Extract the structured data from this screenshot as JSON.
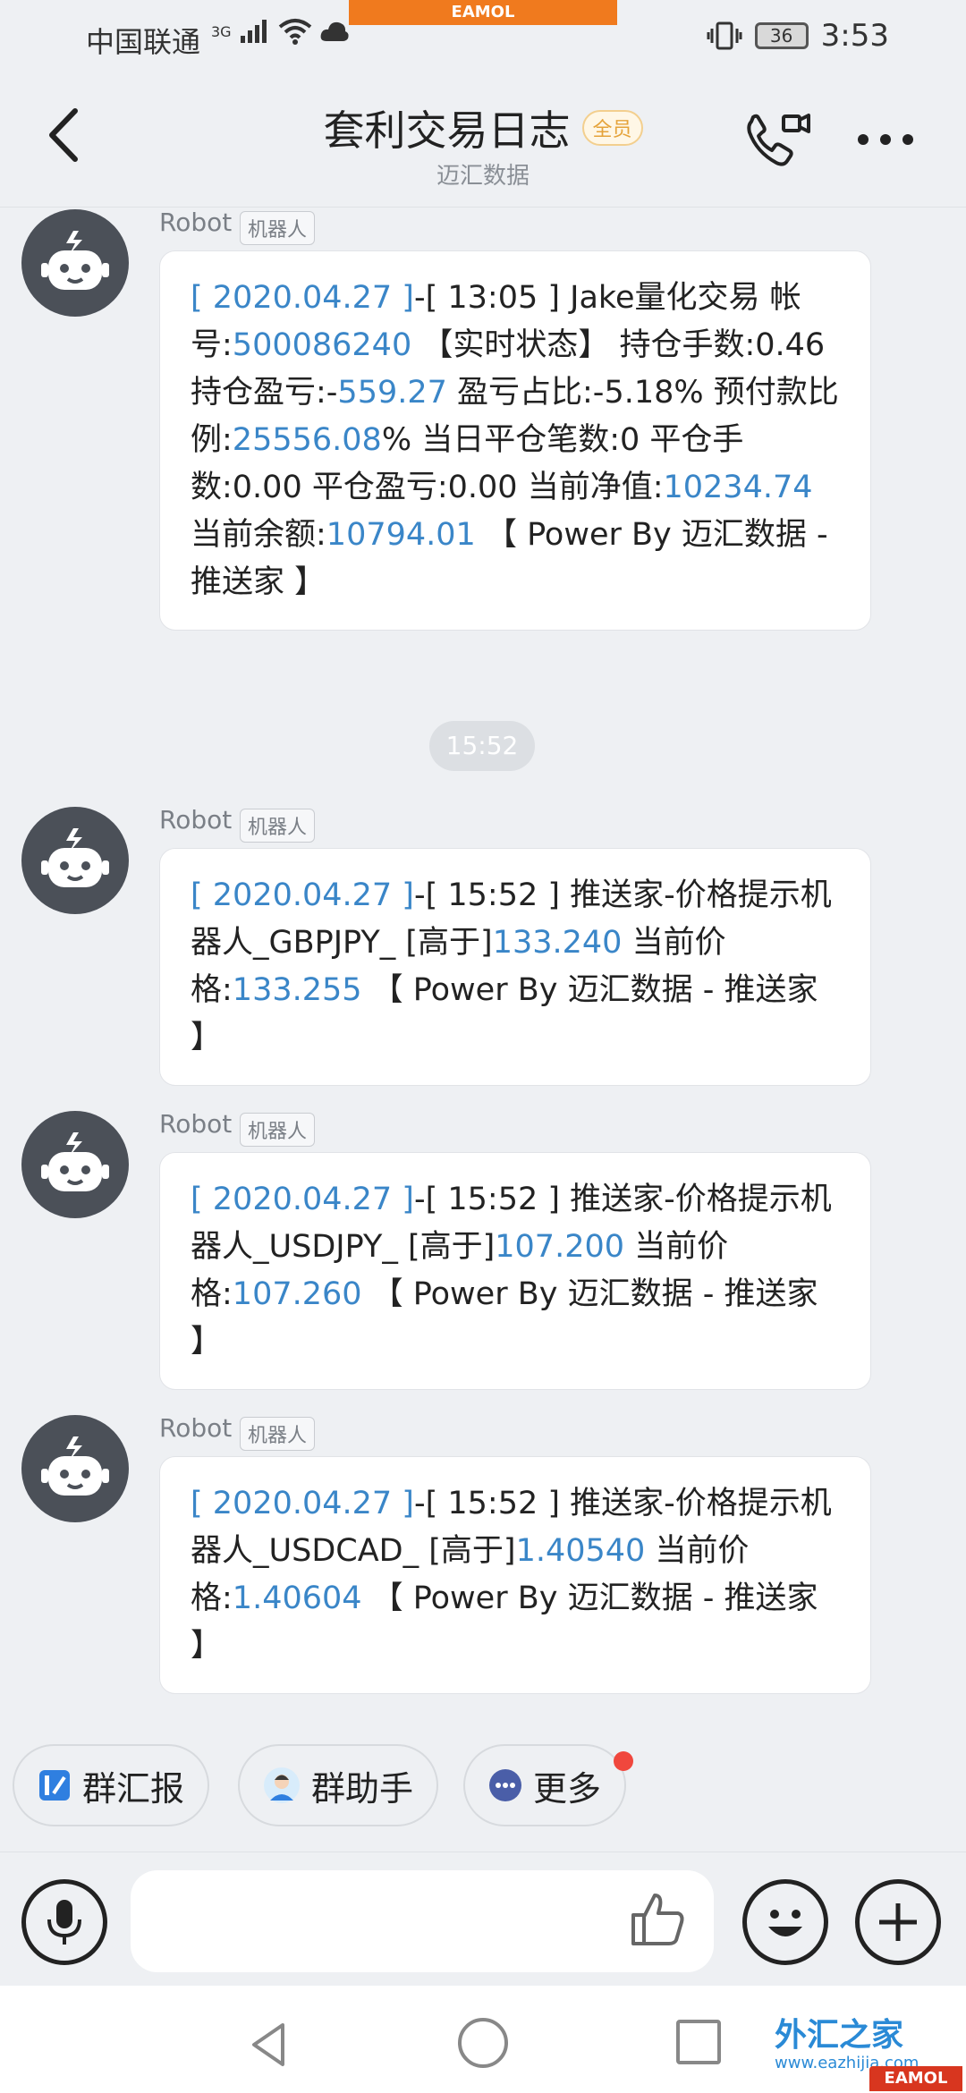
{
  "status_bar": {
    "carrier": "中国联通",
    "network": "3G",
    "battery": "36",
    "time": "3:53",
    "banner": "EAMOL"
  },
  "header": {
    "title": "套利交易日志",
    "member_badge": "全员",
    "subtitle": "迈汇数据"
  },
  "messages": [
    {
      "sender": "Robot",
      "tag": "机器人",
      "parts": [
        {
          "t": "[ 2020.04.27 ]",
          "b": true
        },
        {
          "t": "-[ 13:05 ] Jake量化交易  帐号:",
          "b": false
        },
        {
          "t": "500086240",
          "b": true
        },
        {
          "t": " 【实时状态】 持仓手数:0.46 持仓盈亏:-",
          "b": false
        },
        {
          "t": "559.27",
          "b": true
        },
        {
          "t": "  盈亏占比:-5.18%   预付款比例:",
          "b": false
        },
        {
          "t": "25556.08",
          "b": true
        },
        {
          "t": "%  当日平仓笔数:0   平仓手数:0.00  平仓盈亏:0.00  当前净值:",
          "b": false
        },
        {
          "t": "10234.74",
          "b": true
        },
        {
          "t": " 当前余额:",
          "b": false
        },
        {
          "t": "10794.01",
          "b": true
        },
        {
          "t": "  【 Power By 迈汇数据 - 推送家 】",
          "b": false
        }
      ]
    },
    {
      "sender": "Robot",
      "tag": "机器人",
      "parts": [
        {
          "t": "[ 2020.04.27 ]",
          "b": true
        },
        {
          "t": "-[ 15:52 ] 推送家-价格提示机器人_GBPJPY_ [高于]",
          "b": false
        },
        {
          "t": "133.240",
          "b": true
        },
        {
          "t": " 当前价格:",
          "b": false
        },
        {
          "t": "133.255",
          "b": true
        },
        {
          "t": "  【 Power By 迈汇数据 - 推送家 】",
          "b": false
        }
      ]
    },
    {
      "sender": "Robot",
      "tag": "机器人",
      "parts": [
        {
          "t": "[ 2020.04.27 ]",
          "b": true
        },
        {
          "t": "-[ 15:52 ] 推送家-价格提示机器人_USDJPY_ [高于]",
          "b": false
        },
        {
          "t": "107.200",
          "b": true
        },
        {
          "t": " 当前价格:",
          "b": false
        },
        {
          "t": "107.260",
          "b": true
        },
        {
          "t": "  【 Power By 迈汇数据 - 推送家 】",
          "b": false
        }
      ]
    },
    {
      "sender": "Robot",
      "tag": "机器人",
      "parts": [
        {
          "t": "[ 2020.04.27 ]",
          "b": true
        },
        {
          "t": "-[ 15:52 ] 推送家-价格提示机器人_USDCAD_ [高于]",
          "b": false
        },
        {
          "t": "1.40540",
          "b": true
        },
        {
          "t": " 当前价格:",
          "b": false
        },
        {
          "t": "1.40604",
          "b": true
        },
        {
          "t": "  【 Power By 迈汇数据 - 推送家 】",
          "b": false
        }
      ]
    }
  ],
  "time_divider": "15:52",
  "quick_actions": {
    "report": "群汇报",
    "assistant": "群助手",
    "more": "更多"
  },
  "watermark": {
    "text": "外汇之家",
    "url": "www.eazhijia.com",
    "corner": "EAMOL"
  },
  "colors": {
    "accent_blue": "#3a86c8",
    "background": "#eef0f3",
    "notification_dot": "#f0473d"
  }
}
